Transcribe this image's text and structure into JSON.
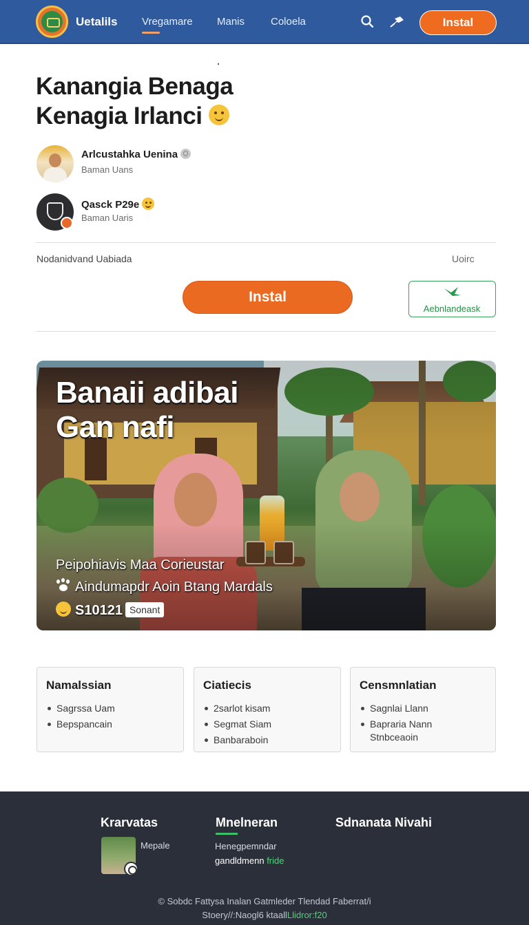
{
  "header": {
    "brand": "Uetalils",
    "nav": [
      "Vregamare",
      "Manis",
      "Coloela"
    ],
    "install_label": "Instal"
  },
  "article": {
    "title_line1": "Kanangia Benaga",
    "title_line2": "Kenagia Irlanci",
    "authors": [
      {
        "name": "Arlcustahka Uenina",
        "sub": "Baman Uans"
      },
      {
        "name": "Qasck P29e",
        "sub": "Baman Uaris"
      }
    ],
    "meta_left": "Nodanidvand Uabiada",
    "meta_right": "Uoirc",
    "install_label": "Instal",
    "alt_label": "Aebnlandeask"
  },
  "hero": {
    "title_line1": "Banaii adibai",
    "title_line2": "Gan nafi",
    "line1": "Peipohiavis Maa Corieustar",
    "line2": "Aindumapdr Aoin Btang Mardals",
    "price": "S10121",
    "tag": "Sonant"
  },
  "cards": [
    {
      "title": "Namalssian",
      "items": [
        "Sagrssa Uam",
        "Bepspancain"
      ],
      "extra": ""
    },
    {
      "title": "Ciatiecis",
      "items": [
        "2sarlot kisam",
        "Segmat Siam",
        "Banbaraboin"
      ],
      "extra": ""
    },
    {
      "title": "Censmnlatian",
      "items": [
        "Sagnlai Llann",
        "Bapraria Nann"
      ],
      "extra": "Stnbceaoin"
    }
  ],
  "footer": {
    "col1_head": "Krarvatas",
    "col1_text": "Mepale",
    "col2_head": "Mnelneran",
    "col2_text": "Henegpemndar",
    "col2_link_a": "gandldmenn",
    "col2_link_b": "fride",
    "col3_head": "Sdnanata Nivahi",
    "copyright_line1": "© Sobdc Fattysa Inalan Gatmleder Tlendad Faberrat/i",
    "copyright_line2_a": "Stoery//:Naogl6 ktaall",
    "copyright_line2_b": "Llidror:f20"
  },
  "colors": {
    "header_bg": "#2f5a9e",
    "accent_orange": "#ea6a22",
    "accent_green": "#3aa05c",
    "footer_bg": "#2b2f3a"
  }
}
